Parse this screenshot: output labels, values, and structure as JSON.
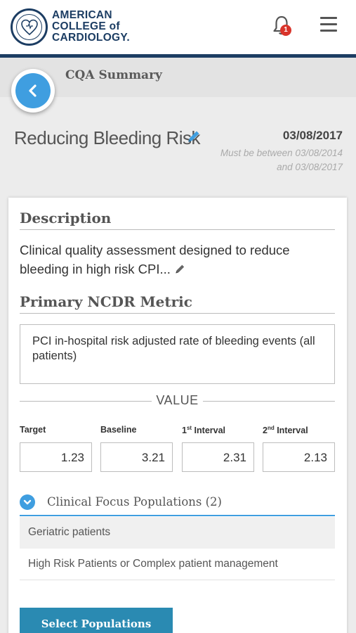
{
  "header": {
    "logo_mark": "ACC",
    "logo_lines": [
      "AMERICAN",
      "COLLEGE of",
      "CARDIOLOGY."
    ],
    "notification_count": "1",
    "brand_color": "#1c3d63",
    "badge_color": "#d9342b"
  },
  "section": {
    "title": "CQA Summary"
  },
  "cqa": {
    "title": "Reducing Bleeding Risk",
    "date": "03/08/2017",
    "date_hint_line1": "Must be between 03/08/2014",
    "date_hint_line2": "and 03/08/2017"
  },
  "description": {
    "heading": "Description",
    "text": "Clinical quality assessment designed to reduce bleeding in high risk CPI..."
  },
  "metric": {
    "heading": "Primary NCDR Metric",
    "text": "PCI in-hospital risk adjusted rate of bleeding events (all patients)"
  },
  "values": {
    "heading": "VALUE",
    "target_label": "Target",
    "target": "1.23",
    "baseline_label": "Baseline",
    "baseline": "3.21",
    "interval1_num": "1",
    "interval1_sup": "st",
    "interval1_word": " Interval",
    "interval1": "2.31",
    "interval2_num": "2",
    "interval2_sup": "nd",
    "interval2_word": " Interval",
    "interval2": "2.13"
  },
  "populations": {
    "heading": "Clinical Focus Populations (2)",
    "items": [
      "Geriatric patients",
      "High Risk Patients or Complex patient management"
    ],
    "button": "Select Populations",
    "accent_color": "#3f9ee0",
    "button_color": "#2a8ab2"
  }
}
